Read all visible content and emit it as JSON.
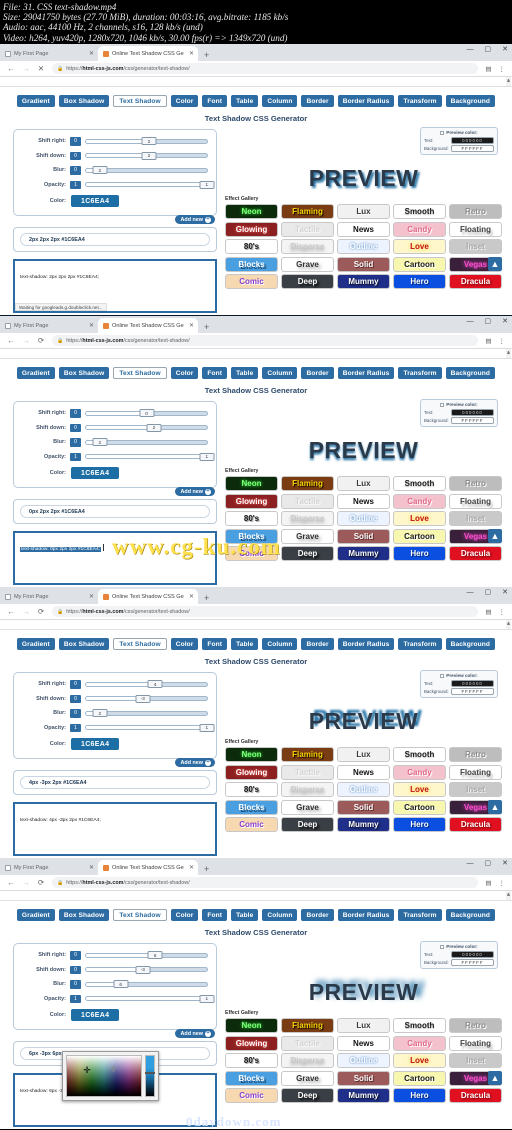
{
  "meta": {
    "lines": [
      "File: 31. CSS text-shadow.mp4",
      "Size: 29041750 bytes (27.70 MiB), duration: 00:03:16, avg.bitrate: 1185 kb/s",
      "Audio: aac, 44100 Hz, 2 channels, s16, 128 kb/s (und)",
      "Video: h264, yuv420p, 1280x720, 1046 kb/s, 30.00 fps(r) => 1349x720 (und)"
    ]
  },
  "browser": {
    "tabs": [
      {
        "title": "My First Page",
        "icon": "document-icon",
        "active": false
      },
      {
        "title": "Online Text Shadow CSS Genera",
        "icon": "orange-favicon",
        "active": true
      }
    ],
    "new_tab_label": "+",
    "window_controls": {
      "minimize": "—",
      "maximize": "▢",
      "close": "✕"
    },
    "nav": {
      "back": "←",
      "forward": "→",
      "reload_p1": "✕",
      "reload": "⟳"
    },
    "url": {
      "scheme": "https://",
      "domain": "html-css-js.com",
      "path": "/css/generator/text-shadow/",
      "lock": "🔒"
    },
    "omni_buttons": {
      "reader": "▤",
      "menu": "⋮"
    }
  },
  "page": {
    "title": "Text Shadow CSS Generator",
    "nav_buttons": [
      "Gradient",
      "Box Shadow",
      "Text Shadow",
      "Color",
      "Font",
      "Table",
      "Column",
      "Border",
      "Border Radius",
      "Transform",
      "Background"
    ],
    "selected_nav": "Text Shadow",
    "preview_text": "PREVIEW",
    "preview_color_panel": {
      "title": "Preview color:",
      "text_label": "Text:",
      "text_value": "000000",
      "background_label": "Background:",
      "background_value": "FFFFFF"
    },
    "controls": {
      "labels": {
        "shift_right": "Shift right:",
        "shift_down": "Shift down:",
        "blur": "Blur:",
        "opacity": "Opacity:",
        "color": "Color:"
      },
      "min_values": {
        "shift_right": "0",
        "shift_down": "0",
        "blur": "0",
        "opacity": "1"
      },
      "color_value": "1C6EA4"
    },
    "add_new_label": "Add new",
    "gallery": {
      "title": "Effect Gallery",
      "items": [
        {
          "label": "Neon",
          "bg": "#0b2b0b",
          "fg": "#7dff7d",
          "shadow": "0 0 3px #39ff39"
        },
        {
          "label": "Flaming",
          "bg": "#7a3c12",
          "fg": "#ffd400",
          "shadow": "1px 1px 1px #000"
        },
        {
          "label": "Lux",
          "bg": "#f1f1f1",
          "fg": "#3a3a3a",
          "shadow": "1px 1px 0 #fff"
        },
        {
          "label": "Smooth",
          "bg": "#ffffff",
          "fg": "#1a1a1a",
          "shadow": "0 1px 1px #bbb"
        },
        {
          "label": "Retro",
          "bg": "#bdbdbd",
          "fg": "#8d8d8d",
          "shadow": "1px 1px 0 #fff"
        },
        {
          "label": "Glowing",
          "bg": "#8c2020",
          "fg": "#ffffff",
          "shadow": "0 0 3px #ff6666"
        },
        {
          "label": "Tactile",
          "bg": "#e9e9e9",
          "fg": "#d3d3d3",
          "shadow": "1px 1px 1px #fff"
        },
        {
          "label": "News",
          "bg": "#ffffff",
          "fg": "#111111",
          "shadow": "none"
        },
        {
          "label": "Candy",
          "bg": "#f4c2cd",
          "fg": "#e06a8a",
          "shadow": "1px 1px 0 #fff"
        },
        {
          "label": "Floating",
          "bg": "#ffffff",
          "fg": "#444444",
          "shadow": "2px 3px 2px #bbb"
        },
        {
          "label": "80's",
          "bg": "#ffffff",
          "fg": "#111111",
          "shadow": "1px 1px 0 #aaa"
        },
        {
          "label": "Disperse",
          "bg": "#f4f4f4",
          "fg": "#c9c9c9",
          "shadow": "0 2px 3px #999"
        },
        {
          "label": "Outline",
          "bg": "#eef4ff",
          "fg": "#ffffff",
          "shadow": "0 0 2px #2f6fb5"
        },
        {
          "label": "Love",
          "bg": "#fff7cc",
          "fg": "#c01020",
          "shadow": "0 0 4px #ffcc00"
        },
        {
          "label": "Inset",
          "bg": "#c9c9c9",
          "fg": "#a8a8a8",
          "shadow": "1px 1px 0 #f0f0f0"
        },
        {
          "label": "Blocks",
          "bg": "#4a9fe0",
          "fg": "#ffffff",
          "shadow": "2px 2px 0 #1d4e7a"
        },
        {
          "label": "Grave",
          "bg": "#ffffff",
          "fg": "#333333",
          "shadow": "2px 2px 3px #999"
        },
        {
          "label": "Solid",
          "bg": "#9c5a5a",
          "fg": "#ffffff",
          "shadow": "1px 1px 0 #5a2b2b"
        },
        {
          "label": "Cartoon",
          "bg": "#f7f7b0",
          "fg": "#1a1a1a",
          "shadow": "1px 1px 0 #fff"
        },
        {
          "label": "Vegas",
          "bg": "#3a1f3a",
          "fg": "#ff4fd2",
          "shadow": "0 0 4px #ff4fd2"
        },
        {
          "label": "Comic",
          "bg": "#f6d9b0",
          "fg": "#8a3fd0",
          "shadow": "1px 1px 0 #fff"
        },
        {
          "label": "Deep",
          "bg": "#3a3f45",
          "fg": "#ffffff",
          "shadow": "2px 2px 2px #000"
        },
        {
          "label": "Mummy",
          "bg": "#1f2f8a",
          "fg": "#ffffff",
          "shadow": "1px 1px 2px #000"
        },
        {
          "label": "Hero",
          "bg": "#0a4fe0",
          "fg": "#ffffff",
          "shadow": "1px 1px 0 #002a80"
        },
        {
          "label": "Dracula",
          "bg": "#e01020",
          "fg": "#ffffff",
          "shadow": "1px 1px 2px #600"
        }
      ]
    },
    "scroll_top_icon": "▲",
    "status_text": "Waiting for googleads.g.doubleclick.net..."
  },
  "panels": [
    {
      "id": "panel-1",
      "shift_right": "2",
      "shift_down": "2",
      "blur": "2",
      "opacity": "1",
      "shift_right_pct": 52,
      "shift_down_pct": 52,
      "blur_pct": 12,
      "opacity_pct": 99,
      "shadow_item": "2px 2px 2px #1C6EA4",
      "code": "text-shadow: 2px 2px 2px #1C6EA4;",
      "code_selected": false,
      "preview_shadow": "2px 2px 2px #1C6EA4",
      "picker_open": false,
      "reload_glyph": "✕"
    },
    {
      "id": "panel-2",
      "shift_right": "0",
      "shift_down": "2",
      "blur": "2",
      "opacity": "1",
      "shift_right_pct": 50,
      "shift_down_pct": 56,
      "blur_pct": 12,
      "opacity_pct": 99,
      "shadow_item": "0px 2px 2px #1C6EA4",
      "code": "text-shadow: 0px 2px 2px #1C6EA4;",
      "code_selected": true,
      "preview_shadow": "0px 2px 2px #1C6EA4",
      "picker_open": false,
      "reload_glyph": "⟳"
    },
    {
      "id": "panel-3",
      "shift_right": "4",
      "shift_down": "-3",
      "blur": "2",
      "opacity": "1",
      "shift_right_pct": 57,
      "shift_down_pct": 47,
      "blur_pct": 12,
      "opacity_pct": 99,
      "shadow_item": "4px -3px 2px #1C6EA4",
      "code": "text-shadow: 4px -3px 2px #1C6EA4;",
      "code_selected": false,
      "preview_shadow": "4px -3px 2px #1C6EA4",
      "picker_open": false,
      "reload_glyph": "⟳"
    },
    {
      "id": "panel-4",
      "shift_right": "6",
      "shift_down": "-3",
      "blur": "6",
      "opacity": "1",
      "shift_right_pct": 57,
      "shift_down_pct": 47,
      "blur_pct": 29,
      "opacity_pct": 99,
      "shadow_item": "6px -3px 6px #1C6EA4",
      "code": "text-shadow: 6px -3px 6px #1C6EA4;",
      "code_selected": false,
      "preview_shadow": "6px -3px 6px #1C6EA4",
      "picker_open": true,
      "reload_glyph": "⟳"
    }
  ],
  "watermarks": {
    "main": "www.cg-ku.com",
    "bottom": "0daydown.com"
  }
}
